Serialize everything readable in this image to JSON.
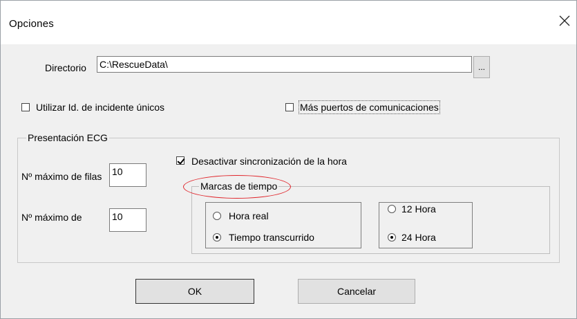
{
  "window": {
    "title": "Opciones"
  },
  "directory": {
    "label": "Directorio",
    "value": "C:\\RescueData\\",
    "browse_label": "..."
  },
  "options": {
    "unique_ids_label": "Utilizar Id. de incidente únicos",
    "unique_ids_checked": false,
    "more_ports_label": "Más puertos de comunicaciones",
    "more_ports_checked": false
  },
  "ecg": {
    "group_title": "Presentación ECG",
    "max_rows_label": "Nº máximo de filas",
    "max_rows_value": "10",
    "max_label": "Nº máximo de",
    "max_value": "10",
    "disable_sync_label": "Desactivar sincronización de la hora",
    "disable_sync_checked": true,
    "timestamps": {
      "title": "Marcas de tiempo",
      "real_time_label": "Hora real",
      "elapsed_label": "Tiempo transcurrido",
      "selected_mode": "elapsed",
      "h12_label": "12 Hora",
      "h24_label": "24 Hora",
      "selected_format": "24"
    }
  },
  "buttons": {
    "ok_label": "OK",
    "cancel_label": "Cancelar"
  },
  "colors": {
    "annotation": "#e0242a"
  }
}
